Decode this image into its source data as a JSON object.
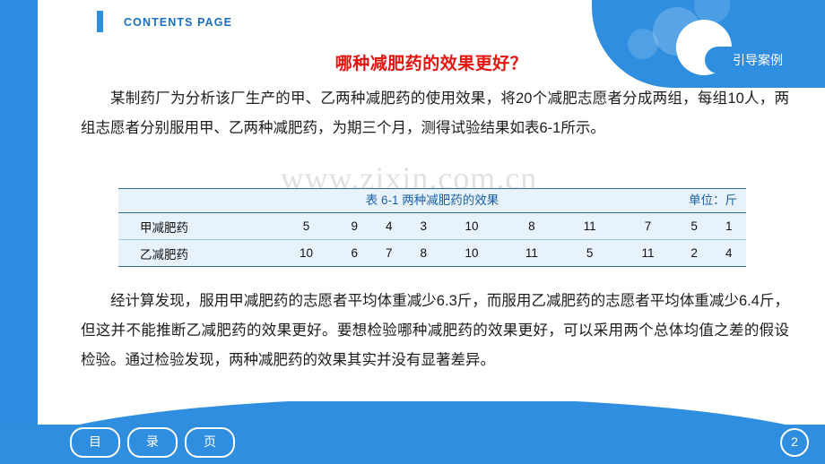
{
  "header": {
    "title": "CONTENTS PAGE",
    "badge_label": "引导案例"
  },
  "slide": {
    "title": "哪种减肥药的效果更好？",
    "paragraph1": "某制药厂为分析该厂生产的甲、乙两种减肥药的使用效果，将20个减肥志愿者分成两组，每组10人，两组志愿者分别服用甲、乙两种减肥药，为期三个月，测得试验结果如表6-1所示。",
    "paragraph2": "经计算发现，服用甲减肥药的志愿者平均体重减少6.3斤，而服用乙减肥药的志愿者平均体重减少6.4斤，但这并不能推断乙减肥药的效果更好。要想检验哪种减肥药的效果更好，可以采用两个总体均值之差的假设检验。通过检验发现，两种减肥药的效果其实并没有显著差异。",
    "watermark": "www.zixin.com.cn"
  },
  "table": {
    "caption": "表 6-1   两种减肥药的效果",
    "unit": "单位：斤",
    "rows": [
      {
        "label": "甲减肥药",
        "values": [
          "5",
          "9",
          "4",
          "3",
          "10",
          "8",
          "11",
          "7",
          "5",
          "1"
        ]
      },
      {
        "label": "乙减肥药",
        "values": [
          "10",
          "6",
          "7",
          "8",
          "10",
          "11",
          "5",
          "11",
          "2",
          "4"
        ]
      }
    ]
  },
  "footer": {
    "nav": [
      "目",
      "录",
      "页"
    ],
    "page_number": "2"
  },
  "colors": {
    "accent": "#2f8ee0",
    "title_red": "#e8130f",
    "header_blue": "#1a6fbf",
    "table_bg": "#e8f2fb"
  }
}
